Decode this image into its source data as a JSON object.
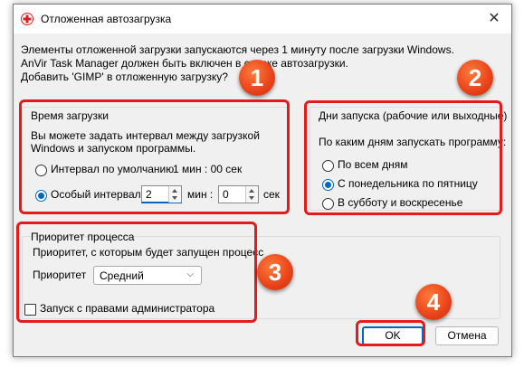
{
  "window": {
    "title": "Отложенная автозагрузка"
  },
  "intro": {
    "line1": "Элементы отложенной загрузки запускаются через 1 минуту после загрузки Windows.",
    "line2": "AnVir Task Manager должен быть включен в списке автозагрузки.",
    "line3": "Добавить 'GIMP' в отложенную загрузку?"
  },
  "load_time": {
    "title": "Время загрузки",
    "desc1": "Вы можете задать интервал между загрузкой",
    "desc2": "Windows и запуском программы.",
    "default_label": "Интервал по умолчанию",
    "default_value": "1 мин : 00 сек",
    "custom_label": "Особый интервал",
    "minutes": "2",
    "min_unit": "мин :",
    "seconds": "0",
    "sec_unit": "сек",
    "selected": "custom"
  },
  "launch_days": {
    "title": "Дни запуска (рабочие или выходные)",
    "question": "По каким дням запускать программу:",
    "options": [
      "По всем дням",
      "С понедельника по пятницу",
      "В субботу и воскресенье"
    ],
    "selected_index": 1
  },
  "priority": {
    "title": "Приоритет процесса",
    "desc": "Приоритет, с которым будет запущен процесс",
    "label": "Приоритет",
    "value": "Средний"
  },
  "admin": {
    "label": "Запуск с правами администратора",
    "checked": false
  },
  "buttons": {
    "ok": "OK",
    "cancel": "Отмена"
  },
  "annotations": {
    "one": "1",
    "two": "2",
    "three": "3",
    "four": "4"
  },
  "colors": {
    "accent": "#0067c0",
    "highlight": "#e41b1b",
    "badge": "#e8421a"
  }
}
